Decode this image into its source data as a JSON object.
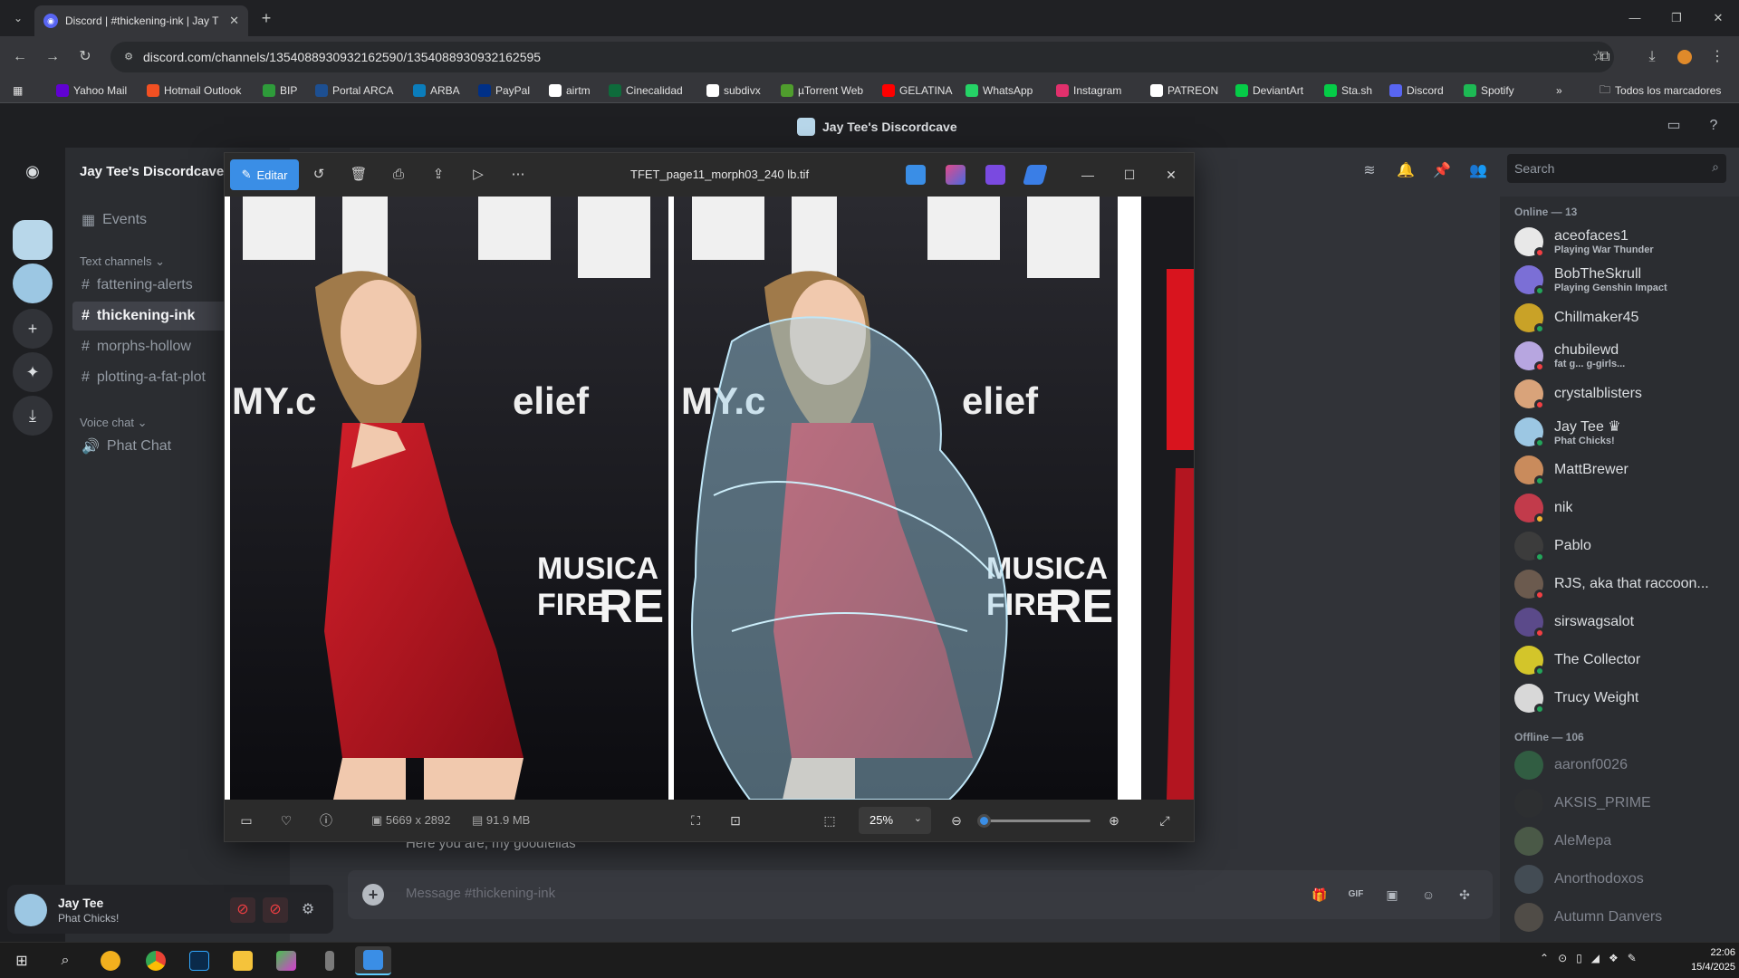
{
  "browser": {
    "tab_title": "Discord | #thickening-ink | Jay T",
    "url": "discord.com/channels/1354088930932162590/1354088930932162595",
    "bookmarks": [
      {
        "label": "Yahoo Mail",
        "color": "#6001d2"
      },
      {
        "label": "Hotmail Outlook",
        "color": "#f25022"
      },
      {
        "label": "BIP",
        "color": "#2e9b3a"
      },
      {
        "label": "Portal ARCA",
        "color": "#1d4f91"
      },
      {
        "label": "ARBA",
        "color": "#0b7dbb"
      },
      {
        "label": "PayPal",
        "color": "#003087"
      },
      {
        "label": "airtm",
        "color": "#ffffff"
      },
      {
        "label": "Cinecalidad",
        "color": "#0e6b3b"
      },
      {
        "label": "subdivx",
        "color": "#ffffff"
      },
      {
        "label": "µTorrent Web",
        "color": "#4f9d2d"
      },
      {
        "label": "GELATINA",
        "color": "#ff0000"
      },
      {
        "label": "WhatsApp",
        "color": "#25d366"
      },
      {
        "label": "Instagram",
        "color": "#e1306c"
      },
      {
        "label": "PATREON",
        "color": "#ffffff"
      },
      {
        "label": "DeviantArt",
        "color": "#05cc47"
      },
      {
        "label": "Sta.sh",
        "color": "#05cc47"
      },
      {
        "label": "Discord",
        "color": "#5865f2"
      },
      {
        "label": "Spotify",
        "color": "#1db954"
      }
    ],
    "all_bookmarks_label": "Todos los marcadores"
  },
  "discord": {
    "window_title": "Jay Tee's Discordcave",
    "server_name": "Jay Tee's Discordcave",
    "events_label": "Events",
    "text_channels_label": "Text channels",
    "text_channels": [
      "fattening-alerts",
      "thickening-ink",
      "morphs-hollow",
      "plotting-a-fat-plot"
    ],
    "voice_chat_label": "Voice chat",
    "voice_channels": [
      "Phat Chat"
    ],
    "search_placeholder": "Search",
    "message_text": "Here you are, my goodfellas",
    "composer_placeholder": "Message #thickening-ink",
    "user": {
      "name": "Jay Tee",
      "status": "Phat Chicks!"
    },
    "online_header": "Online — 13",
    "offline_header": "Offline — 106",
    "online_members": [
      {
        "name": "aceofaces1",
        "activity": "Playing War Thunder",
        "color": "#e8e8e8",
        "status": "#f23f43"
      },
      {
        "name": "BobTheSkrull",
        "activity": "Playing Genshin Impact",
        "color": "#7b6fd6",
        "status": "#23a55a"
      },
      {
        "name": "Chillmaker45",
        "activity": "",
        "color": "#c9a227",
        "status": "#23a55a"
      },
      {
        "name": "chubilewd",
        "activity": "fat g... g-girls...",
        "color": "#b7a6e0",
        "status": "#f23f43"
      },
      {
        "name": "crystalblisters",
        "activity": "",
        "color": "#d9a37a",
        "status": "#f23f43"
      },
      {
        "name": "Jay Tee ♛",
        "activity": "Phat Chicks!",
        "color": "#9cc7e3",
        "status": "#23a55a"
      },
      {
        "name": "MattBrewer",
        "activity": "",
        "color": "#c98b5c",
        "status": "#23a55a"
      },
      {
        "name": "nik",
        "activity": "",
        "color": "#c23b4b",
        "status": "#f0b232"
      },
      {
        "name": "Pablo",
        "activity": "",
        "color": "#3c3c3c",
        "status": "#23a55a"
      },
      {
        "name": "RJS, aka that raccoon...",
        "activity": "",
        "color": "#6b5a4e",
        "status": "#f23f43"
      },
      {
        "name": "sirswagsalot",
        "activity": "",
        "color": "#5b4a8a",
        "status": "#f23f43"
      },
      {
        "name": "The Collector",
        "activity": "",
        "color": "#d3c52a",
        "status": "#23a55a"
      },
      {
        "name": "Trucy Weight",
        "activity": "",
        "color": "#d8d8d8",
        "status": "#23a55a"
      }
    ],
    "offline_members": [
      {
        "name": "aaronf0026",
        "color": "#3ba55c"
      },
      {
        "name": "AKSIS_PRIME",
        "color": "#333333"
      },
      {
        "name": "AleMepa",
        "color": "#7a9a6a"
      },
      {
        "name": "Anorthodoxos",
        "color": "#6a7a8a"
      },
      {
        "name": "Autumn Danvers",
        "color": "#8a7a6a"
      }
    ]
  },
  "viewer": {
    "edit_label": "Editar",
    "filename": "TFET_page11_morph03_240 lb.tif",
    "dimensions": "5669 x 2892",
    "file_size": "91.9 MB",
    "zoom": "25%",
    "zoom_slider_level": 0.05
  },
  "taskbar": {
    "time": "22:06",
    "date": "15/4/2025"
  }
}
